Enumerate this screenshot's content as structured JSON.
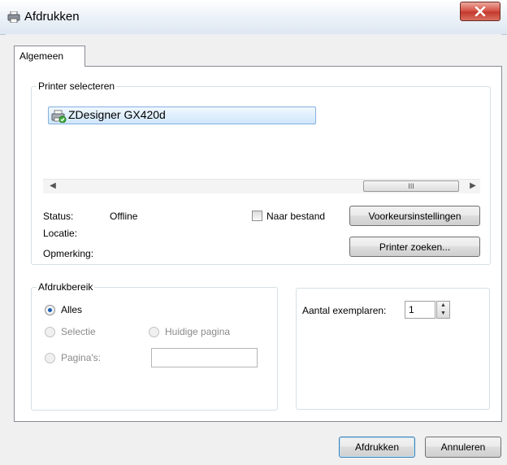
{
  "window": {
    "title": "Afdrukken",
    "close_icon": "close-icon"
  },
  "tabs": [
    {
      "label": "Algemeen",
      "selected": true
    }
  ],
  "printer_select": {
    "legend": "Printer selecteren",
    "printers": [
      {
        "name": "ZDesigner GX420d",
        "selected": true,
        "icon": "printer-default-icon"
      }
    ],
    "scroll_thumb_glyph": "III"
  },
  "printer_info": {
    "status_label": "Status:",
    "status_value": "Offline",
    "location_label": "Locatie:",
    "comment_label": "Opmerking:",
    "print_to_file_label": "Naar bestand",
    "print_to_file_checked": false,
    "preferences_button": "Voorkeursinstellingen",
    "find_printer_button": "Printer zoeken..."
  },
  "page_range": {
    "legend": "Afdrukbereik",
    "all_label": "Alles",
    "all_selected": true,
    "selection_label": "Selectie",
    "current_page_label": "Huidige pagina",
    "pages_label": "Pagina's:",
    "pages_value": ""
  },
  "copies": {
    "label": "Aantal exemplaren:",
    "value": "1"
  },
  "footer": {
    "print_button": "Afdrukken",
    "cancel_button": "Annuleren"
  },
  "colors": {
    "close_button": "#c9463a",
    "selection_highlight": "#cfe6fb",
    "radio_dot": "#1b5fb3"
  }
}
